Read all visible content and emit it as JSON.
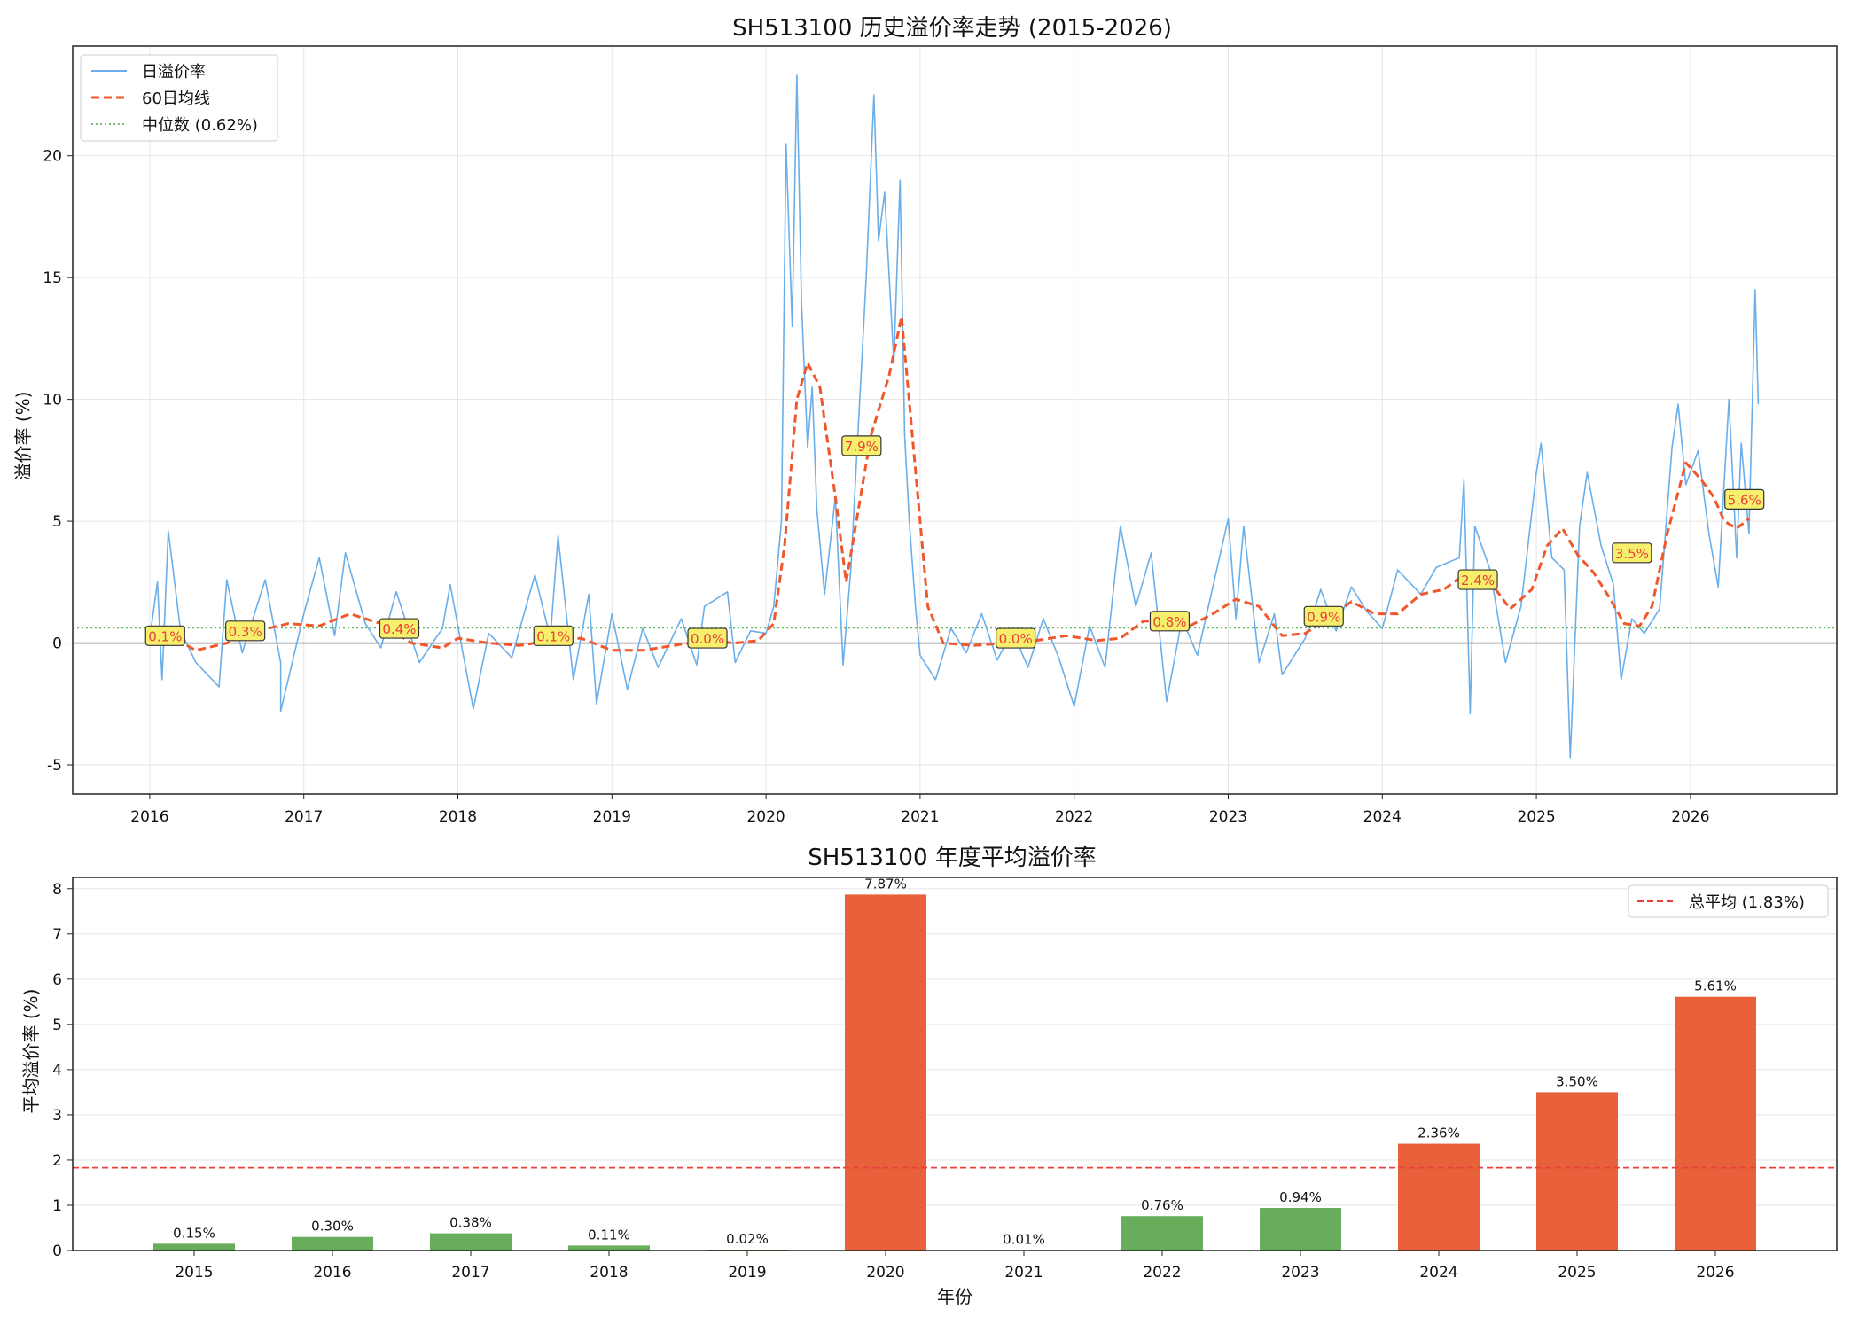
{
  "colors": {
    "daily": "#6aaeea",
    "ma": "#f0582c",
    "median": "#5cb85c",
    "bar_high": "#e8613b",
    "bar_low": "#68ad5c",
    "avg_line": "#e8413a",
    "annotation_bg": "#f5ef6c",
    "grid": "#e6e6e6"
  },
  "chart_data": [
    {
      "type": "line",
      "title": "SH513100 历史溢价率走势 (2015-2026)",
      "xlabel": "",
      "ylabel": "溢价率 (%)",
      "x_ticks": [
        "2016",
        "2017",
        "2018",
        "2019",
        "2020",
        "2021",
        "2022",
        "2023",
        "2024",
        "2025",
        "2026"
      ],
      "y_ticks": [
        "-5",
        "0",
        "5",
        "10",
        "15",
        "20"
      ],
      "xlim": [
        2015.5,
        2026.95
      ],
      "ylim": [
        -6.2,
        24.5
      ],
      "grid": true,
      "legend_position": "top-left",
      "legend": [
        "日溢价率",
        "60日均线",
        "中位数 (0.62%)"
      ],
      "series": [
        {
          "name": "日溢价率",
          "style": "solid",
          "points": [
            [
              2016.0,
              0.2
            ],
            [
              2016.05,
              2.5
            ],
            [
              2016.08,
              -1.5
            ],
            [
              2016.12,
              4.6
            ],
            [
              2016.2,
              0.5
            ],
            [
              2016.3,
              -0.8
            ],
            [
              2016.45,
              -1.8
            ],
            [
              2016.5,
              2.6
            ],
            [
              2016.6,
              -0.4
            ],
            [
              2016.75,
              2.6
            ],
            [
              2016.85,
              -0.8
            ],
            [
              2016.85,
              -2.8
            ],
            [
              2017.0,
              1.2
            ],
            [
              2017.1,
              3.5
            ],
            [
              2017.2,
              0.3
            ],
            [
              2017.27,
              3.7
            ],
            [
              2017.4,
              0.8
            ],
            [
              2017.5,
              -0.2
            ],
            [
              2017.6,
              2.1
            ],
            [
              2017.75,
              -0.8
            ],
            [
              2017.9,
              0.6
            ],
            [
              2017.95,
              2.4
            ],
            [
              2018.1,
              -2.7
            ],
            [
              2018.2,
              0.4
            ],
            [
              2018.35,
              -0.6
            ],
            [
              2018.5,
              2.8
            ],
            [
              2018.6,
              0.2
            ],
            [
              2018.65,
              4.4
            ],
            [
              2018.75,
              -1.5
            ],
            [
              2018.85,
              2.0
            ],
            [
              2018.9,
              -2.5
            ],
            [
              2019.0,
              1.2
            ],
            [
              2019.1,
              -1.9
            ],
            [
              2019.2,
              0.6
            ],
            [
              2019.3,
              -1.0
            ],
            [
              2019.45,
              1.0
            ],
            [
              2019.55,
              -0.9
            ],
            [
              2019.6,
              1.5
            ],
            [
              2019.75,
              2.1
            ],
            [
              2019.8,
              -0.8
            ],
            [
              2019.9,
              0.5
            ],
            [
              2020.0,
              0.4
            ],
            [
              2020.05,
              1.5
            ],
            [
              2020.1,
              5.0
            ],
            [
              2020.13,
              20.5
            ],
            [
              2020.17,
              13.0
            ],
            [
              2020.2,
              23.3
            ],
            [
              2020.23,
              14.0
            ],
            [
              2020.27,
              8.0
            ],
            [
              2020.3,
              10.5
            ],
            [
              2020.33,
              5.5
            ],
            [
              2020.38,
              2.0
            ],
            [
              2020.45,
              6.0
            ],
            [
              2020.5,
              -0.9
            ],
            [
              2020.55,
              3.0
            ],
            [
              2020.6,
              9.0
            ],
            [
              2020.65,
              15.0
            ],
            [
              2020.7,
              22.5
            ],
            [
              2020.73,
              16.5
            ],
            [
              2020.77,
              18.5
            ],
            [
              2020.83,
              11.5
            ],
            [
              2020.87,
              19.0
            ],
            [
              2020.9,
              8.5
            ],
            [
              2020.93,
              5.0
            ],
            [
              2020.97,
              1.5
            ],
            [
              2021.0,
              -0.5
            ],
            [
              2021.1,
              -1.5
            ],
            [
              2021.2,
              0.6
            ],
            [
              2021.3,
              -0.4
            ],
            [
              2021.4,
              1.2
            ],
            [
              2021.5,
              -0.7
            ],
            [
              2021.6,
              0.5
            ],
            [
              2021.7,
              -1.0
            ],
            [
              2021.8,
              1.0
            ],
            [
              2021.9,
              -0.6
            ],
            [
              2022.0,
              -2.6
            ],
            [
              2022.1,
              0.7
            ],
            [
              2022.2,
              -1.0
            ],
            [
              2022.3,
              4.8
            ],
            [
              2022.4,
              1.5
            ],
            [
              2022.5,
              3.7
            ],
            [
              2022.6,
              -2.4
            ],
            [
              2022.7,
              1.0
            ],
            [
              2022.8,
              -0.5
            ],
            [
              2022.9,
              2.3
            ],
            [
              2023.0,
              5.1
            ],
            [
              2023.05,
              1.0
            ],
            [
              2023.1,
              4.8
            ],
            [
              2023.2,
              -0.8
            ],
            [
              2023.3,
              1.2
            ],
            [
              2023.35,
              -1.3
            ],
            [
              2023.5,
              0.2
            ],
            [
              2023.6,
              2.2
            ],
            [
              2023.7,
              0.5
            ],
            [
              2023.8,
              2.3
            ],
            [
              2023.9,
              1.3
            ],
            [
              2024.0,
              0.6
            ],
            [
              2024.1,
              3.0
            ],
            [
              2024.25,
              2.0
            ],
            [
              2024.35,
              3.1
            ],
            [
              2024.5,
              3.5
            ],
            [
              2024.53,
              6.7
            ],
            [
              2024.57,
              -2.9
            ],
            [
              2024.6,
              4.8
            ],
            [
              2024.7,
              3.0
            ],
            [
              2024.8,
              -0.8
            ],
            [
              2024.9,
              1.5
            ],
            [
              2025.0,
              7.0
            ],
            [
              2025.03,
              8.2
            ],
            [
              2025.1,
              3.5
            ],
            [
              2025.18,
              3.0
            ],
            [
              2025.22,
              -4.7
            ],
            [
              2025.28,
              4.8
            ],
            [
              2025.33,
              7.0
            ],
            [
              2025.42,
              4.0
            ],
            [
              2025.5,
              2.4
            ],
            [
              2025.55,
              -1.5
            ],
            [
              2025.62,
              1.0
            ],
            [
              2025.7,
              0.4
            ],
            [
              2025.8,
              1.4
            ],
            [
              2025.88,
              8.0
            ],
            [
              2025.92,
              9.8
            ],
            [
              2025.97,
              6.5
            ],
            [
              2026.05,
              7.9
            ],
            [
              2026.12,
              4.5
            ],
            [
              2026.18,
              2.3
            ],
            [
              2026.25,
              10.0
            ],
            [
              2026.3,
              3.5
            ],
            [
              2026.33,
              8.2
            ],
            [
              2026.38,
              4.5
            ],
            [
              2026.42,
              14.5
            ],
            [
              2026.44,
              9.8
            ]
          ]
        },
        {
          "name": "60日均线",
          "style": "dashed",
          "points": [
            [
              2016.1,
              0.4
            ],
            [
              2016.3,
              -0.3
            ],
            [
              2016.5,
              0.0
            ],
            [
              2016.7,
              0.5
            ],
            [
              2016.9,
              0.8
            ],
            [
              2017.1,
              0.7
            ],
            [
              2017.3,
              1.2
            ],
            [
              2017.5,
              0.8
            ],
            [
              2017.7,
              0.0
            ],
            [
              2017.9,
              -0.2
            ],
            [
              2018.0,
              0.2
            ],
            [
              2018.2,
              0.0
            ],
            [
              2018.4,
              -0.1
            ],
            [
              2018.6,
              0.1
            ],
            [
              2018.8,
              0.2
            ],
            [
              2019.0,
              -0.3
            ],
            [
              2019.2,
              -0.3
            ],
            [
              2019.4,
              -0.1
            ],
            [
              2019.6,
              0.1
            ],
            [
              2019.8,
              0.0
            ],
            [
              2019.95,
              0.1
            ],
            [
              2020.05,
              0.8
            ],
            [
              2020.12,
              4.0
            ],
            [
              2020.2,
              10.0
            ],
            [
              2020.27,
              11.5
            ],
            [
              2020.35,
              10.5
            ],
            [
              2020.45,
              6.0
            ],
            [
              2020.52,
              2.5
            ],
            [
              2020.6,
              5.5
            ],
            [
              2020.68,
              8.5
            ],
            [
              2020.8,
              11.0
            ],
            [
              2020.88,
              13.4
            ],
            [
              2020.95,
              8.5
            ],
            [
              2021.05,
              1.5
            ],
            [
              2021.15,
              0.0
            ],
            [
              2021.35,
              -0.1
            ],
            [
              2021.55,
              0.0
            ],
            [
              2021.75,
              0.1
            ],
            [
              2021.95,
              0.3
            ],
            [
              2022.15,
              0.1
            ],
            [
              2022.3,
              0.2
            ],
            [
              2022.45,
              0.9
            ],
            [
              2022.6,
              0.9
            ],
            [
              2022.75,
              0.7
            ],
            [
              2022.9,
              1.2
            ],
            [
              2023.05,
              1.8
            ],
            [
              2023.2,
              1.5
            ],
            [
              2023.35,
              0.3
            ],
            [
              2023.5,
              0.4
            ],
            [
              2023.65,
              1.0
            ],
            [
              2023.8,
              1.7
            ],
            [
              2023.95,
              1.2
            ],
            [
              2024.1,
              1.2
            ],
            [
              2024.25,
              2.0
            ],
            [
              2024.4,
              2.2
            ],
            [
              2024.55,
              2.9
            ],
            [
              2024.7,
              2.5
            ],
            [
              2024.83,
              1.4
            ],
            [
              2024.97,
              2.2
            ],
            [
              2025.07,
              4.0
            ],
            [
              2025.17,
              4.7
            ],
            [
              2025.27,
              3.6
            ],
            [
              2025.37,
              2.9
            ],
            [
              2025.47,
              1.9
            ],
            [
              2025.57,
              0.8
            ],
            [
              2025.67,
              0.7
            ],
            [
              2025.75,
              1.5
            ],
            [
              2025.85,
              4.5
            ],
            [
              2025.97,
              7.4
            ],
            [
              2026.07,
              6.7
            ],
            [
              2026.15,
              6.0
            ],
            [
              2026.22,
              5.0
            ],
            [
              2026.3,
              4.7
            ],
            [
              2026.38,
              5.1
            ]
          ]
        },
        {
          "name": "中位数 (0.62%)",
          "style": "dotted",
          "value": 0.62
        }
      ],
      "annotations": [
        {
          "x": 2016.1,
          "y": 0.3,
          "label": "0.1%"
        },
        {
          "x": 2016.62,
          "y": 0.5,
          "label": "0.3%"
        },
        {
          "x": 2017.62,
          "y": 0.6,
          "label": "0.4%"
        },
        {
          "x": 2018.62,
          "y": 0.3,
          "label": "0.1%"
        },
        {
          "x": 2019.62,
          "y": 0.2,
          "label": "0.0%"
        },
        {
          "x": 2020.62,
          "y": 8.1,
          "label": "7.9%"
        },
        {
          "x": 2021.62,
          "y": 0.2,
          "label": "0.0%"
        },
        {
          "x": 2022.62,
          "y": 0.9,
          "label": "0.8%"
        },
        {
          "x": 2023.62,
          "y": 1.1,
          "label": "0.9%"
        },
        {
          "x": 2024.62,
          "y": 2.6,
          "label": "2.4%"
        },
        {
          "x": 2025.62,
          "y": 3.7,
          "label": "3.5%"
        },
        {
          "x": 2026.35,
          "y": 5.9,
          "label": "5.6%"
        }
      ]
    },
    {
      "type": "bar",
      "title": "SH513100 年度平均溢价率",
      "xlabel": "年份",
      "ylabel": "平均溢价率 (%)",
      "categories": [
        "2015",
        "2016",
        "2017",
        "2018",
        "2019",
        "2020",
        "2021",
        "2022",
        "2023",
        "2024",
        "2025",
        "2026"
      ],
      "values": [
        0.15,
        0.3,
        0.38,
        0.11,
        0.02,
        7.87,
        0.01,
        0.76,
        0.94,
        2.36,
        3.5,
        5.61
      ],
      "value_labels": [
        "0.15%",
        "0.30%",
        "0.38%",
        "0.11%",
        "0.02%",
        "7.87%",
        "0.01%",
        "0.76%",
        "0.94%",
        "2.36%",
        "3.50%",
        "5.61%"
      ],
      "y_ticks": [
        "0",
        "1",
        "2",
        "3",
        "4",
        "5",
        "6",
        "7",
        "8"
      ],
      "ylim": [
        0,
        8.25
      ],
      "grid": true,
      "legend_position": "top-right",
      "legend": [
        "总平均 (1.83%)"
      ],
      "reference_line": {
        "name": "总平均 (1.83%)",
        "value": 1.83,
        "style": "dashed"
      }
    }
  ]
}
